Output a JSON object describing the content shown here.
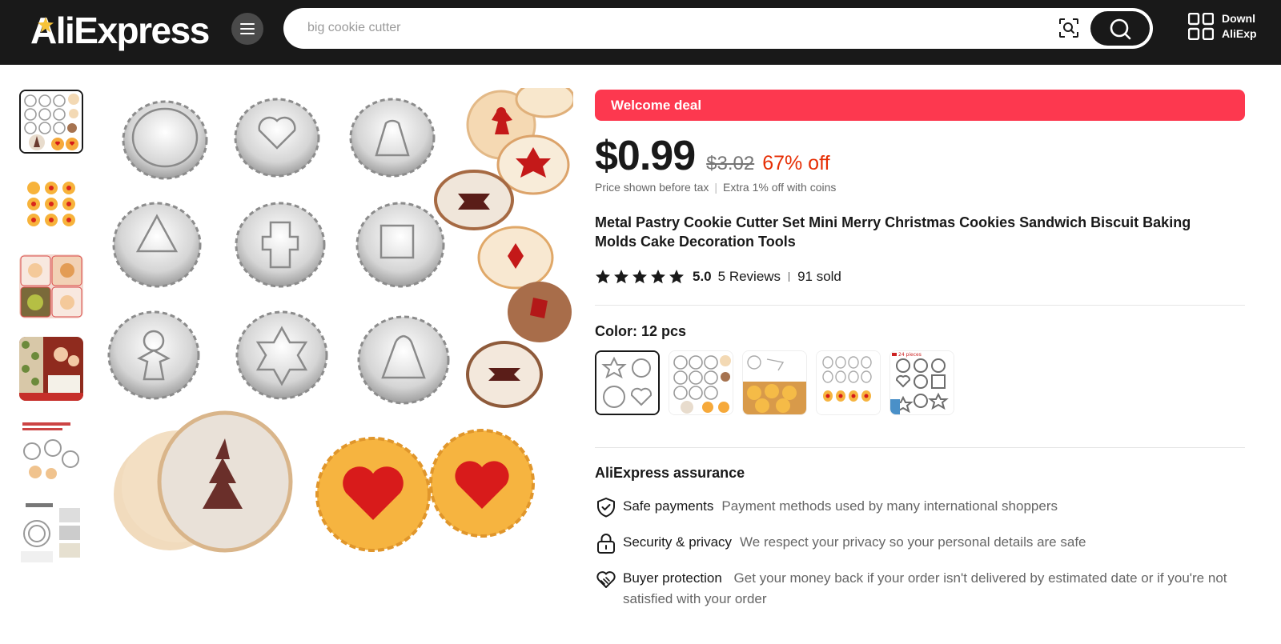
{
  "header": {
    "logo_text": "AliExpress",
    "search_placeholder": "big cookie cutter",
    "app_download_line1": "Downl",
    "app_download_line2": "AliExp",
    "icons": [
      "menu-icon",
      "camera-search-icon",
      "search-icon",
      "qr-code-icon"
    ]
  },
  "gallery": {
    "thumbnails": [
      "cutter-grid",
      "cookies-jam",
      "cookies-tray",
      "family-baking",
      "cutter-info",
      "features"
    ],
    "active_index": 0
  },
  "product": {
    "deal_label": "Welcome deal",
    "price": "$0.99",
    "original_price": "$3.02",
    "discount": "67% off",
    "tax_note": "Price shown before tax",
    "coins_note": "Extra 1% off with coins",
    "title": "Metal Pastry Cookie Cutter Set Mini Merry Christmas Cookies Sandwich Biscuit Baking Molds Cake Decoration Tools",
    "rating": "5.0",
    "reviews": "5 Reviews",
    "sold": "91 sold",
    "color_label": "Color: 12 pcs",
    "variant_banner_text": "24 pieces"
  },
  "assurance": {
    "title": "AliExpress assurance",
    "items": [
      {
        "label": "Safe payments",
        "desc": "Payment methods used by many international shoppers",
        "icon": "shield-check-icon"
      },
      {
        "label": "Security & privacy",
        "desc": "We respect your privacy so your personal details are safe",
        "icon": "lock-icon"
      },
      {
        "label": "Buyer protection",
        "desc": "Get your money back if your order isn't delivered by estimated date or if you're not satisfied with your order",
        "icon": "handshake-heart-icon"
      }
    ]
  },
  "colors": {
    "header_bg": "#191919",
    "deal_bg": "#fd384f",
    "discount": "#e62e04"
  }
}
